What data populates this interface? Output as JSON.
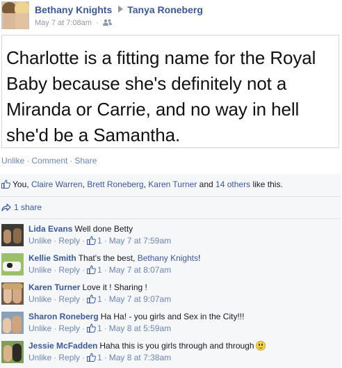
{
  "header": {
    "author": "Bethany Knights",
    "target": "Tanya Roneberg",
    "timestamp": "May 7 at 7:08am",
    "audience_icon": "friends-icon"
  },
  "post": {
    "image_text": "Charlotte is a fitting name for the Royal Baby because she's definitely not a Miranda or Carrie, and no way in hell she'd be a Samantha."
  },
  "actions": {
    "unlike": "Unlike",
    "comment": "Comment",
    "share": "Share",
    "separator": "·"
  },
  "likes": {
    "you": "You,",
    "names": [
      "Claire Warren",
      "Brett Roneberg",
      "Karen Turner"
    ],
    "comma": ",",
    "and": "and",
    "others": "14 others",
    "suffix": "like this."
  },
  "shares": {
    "label": "1 share"
  },
  "comments": [
    {
      "author": "Lida Evans",
      "text": "Well done Betty",
      "link": "",
      "text_after": "",
      "unlike": "Unlike",
      "reply": "Reply",
      "likes": "1",
      "time": "May 7 at 7:59am"
    },
    {
      "author": "Kellie Smith",
      "text": "That's the best,",
      "link": "Bethany Knights",
      "text_after": "!",
      "unlike": "Unlike",
      "reply": "Reply",
      "likes": "1",
      "time": "May 7 at 8:07am"
    },
    {
      "author": "Karen Turner",
      "text": "Love it ! Sharing !",
      "link": "",
      "text_after": "",
      "unlike": "Unlike",
      "reply": "Reply",
      "likes": "1",
      "time": "May 7 at 9:07am"
    },
    {
      "author": "Sharon Roneberg",
      "text": "Ha Ha! - you girls and Sex in the City!!!",
      "link": "",
      "text_after": "",
      "unlike": "Unlike",
      "reply": "Reply",
      "likes": "1",
      "time": "May 8 at 5:59am"
    },
    {
      "author": "Jessie McFadden",
      "text": "Haha this is you girls through and through",
      "link": "",
      "text_after": "",
      "unlike": "Unlike",
      "reply": "Reply",
      "likes": "1",
      "time": "May 8 at 7:38am",
      "emoji": "smiley-icon"
    }
  ],
  "colors": {
    "link": "#3b5998",
    "muted_link": "#6d84b4",
    "meta": "#9197a3",
    "feedback_bg": "#f6f7f9"
  }
}
